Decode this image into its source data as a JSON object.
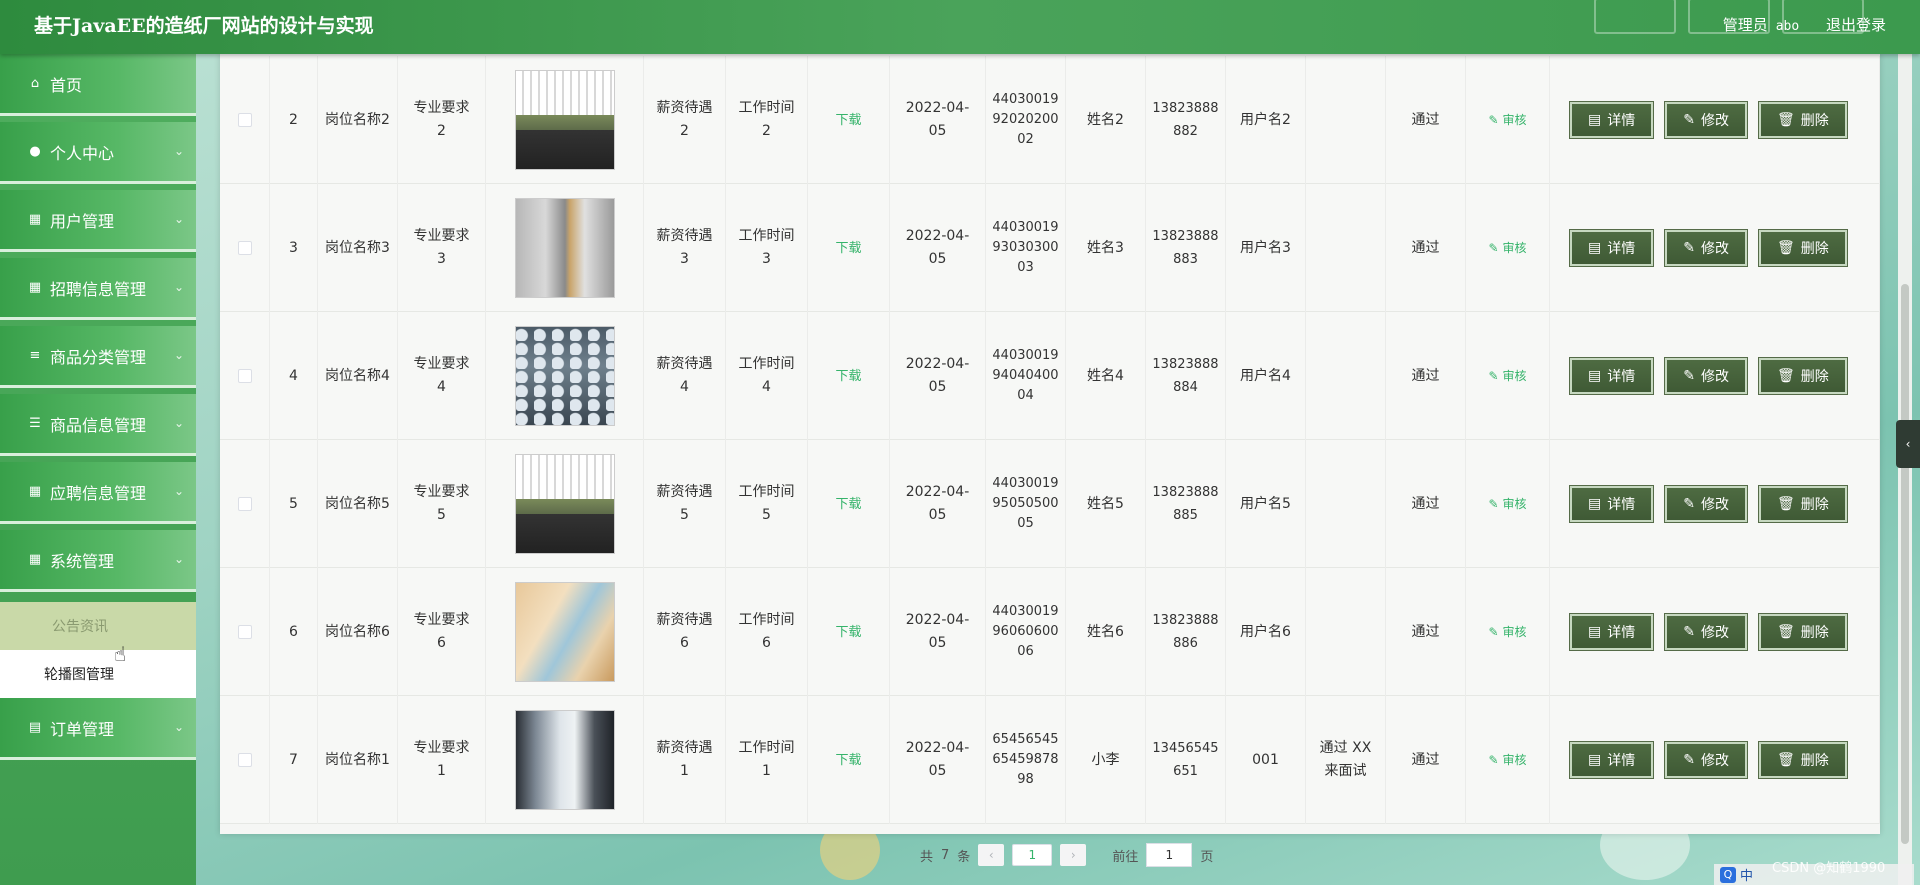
{
  "header": {
    "title": "基于JavaEE的造纸厂网站的设计与实现",
    "user_role": "管理员",
    "user_name": "abo",
    "logout": "退出登录"
  },
  "sidebar": {
    "items": [
      {
        "label": "首页",
        "icon": "home-icon"
      },
      {
        "label": "个人中心",
        "icon": "user-icon"
      },
      {
        "label": "用户管理",
        "icon": "grid-icon"
      },
      {
        "label": "招聘信息管理",
        "icon": "grid-icon"
      },
      {
        "label": "商品分类管理",
        "icon": "sliders-icon"
      },
      {
        "label": "商品信息管理",
        "icon": "list-icon"
      },
      {
        "label": "应聘信息管理",
        "icon": "grid-icon"
      },
      {
        "label": "系统管理",
        "icon": "grid-icon"
      }
    ],
    "submenu": [
      {
        "label": "公告资讯"
      },
      {
        "label": "轮播图管理"
      }
    ],
    "last_item": {
      "label": "订单管理",
      "icon": "clipboard-icon"
    }
  },
  "table": {
    "rows": [
      {
        "index": "2",
        "name": "岗位名称2",
        "req": [
          "专业要求",
          "2"
        ],
        "salary": [
          "薪资待遇",
          "2"
        ],
        "worktime": [
          "工作时间",
          "2"
        ],
        "download": "下载",
        "date": [
          "2022-04-",
          "05"
        ],
        "idno": [
          "44030019",
          "92020200",
          "02"
        ],
        "person": "姓名2",
        "phone": [
          "13823888",
          "882"
        ],
        "username": "用户名2",
        "reply": [],
        "status": "通过",
        "audit": "审核",
        "thumb": "office-bright"
      },
      {
        "index": "3",
        "name": "岗位名称3",
        "req": [
          "专业要求",
          "3"
        ],
        "salary": [
          "薪资待遇",
          "3"
        ],
        "worktime": [
          "工作时间",
          "3"
        ],
        "download": "下载",
        "date": [
          "2022-04-",
          "05"
        ],
        "idno": [
          "44030019",
          "93030300",
          "03"
        ],
        "person": "姓名3",
        "phone": [
          "13823888",
          "883"
        ],
        "username": "用户名3",
        "reply": [],
        "status": "通过",
        "audit": "审核",
        "thumb": "office-gray"
      },
      {
        "index": "4",
        "name": "岗位名称4",
        "req": [
          "专业要求",
          "4"
        ],
        "salary": [
          "薪资待遇",
          "4"
        ],
        "worktime": [
          "工作时间",
          "4"
        ],
        "download": "下载",
        "date": [
          "2022-04-",
          "05"
        ],
        "idno": [
          "44030019",
          "94040400",
          "04"
        ],
        "person": "姓名4",
        "phone": [
          "13823888",
          "884"
        ],
        "username": "用户名4",
        "reply": [],
        "status": "通过",
        "audit": "审核",
        "thumb": "office-crowd"
      },
      {
        "index": "5",
        "name": "岗位名称5",
        "req": [
          "专业要求",
          "5"
        ],
        "salary": [
          "薪资待遇",
          "5"
        ],
        "worktime": [
          "工作时间",
          "5"
        ],
        "download": "下载",
        "date": [
          "2022-04-",
          "05"
        ],
        "idno": [
          "44030019",
          "95050500",
          "05"
        ],
        "person": "姓名5",
        "phone": [
          "13823888",
          "885"
        ],
        "username": "用户名5",
        "reply": [],
        "status": "通过",
        "audit": "审核",
        "thumb": "office-bright"
      },
      {
        "index": "6",
        "name": "岗位名称6",
        "req": [
          "专业要求",
          "6"
        ],
        "salary": [
          "薪资待遇",
          "6"
        ],
        "worktime": [
          "工作时间",
          "6"
        ],
        "download": "下载",
        "date": [
          "2022-04-",
          "05"
        ],
        "idno": [
          "44030019",
          "96060600",
          "06"
        ],
        "person": "姓名6",
        "phone": [
          "13823888",
          "886"
        ],
        "username": "用户名6",
        "reply": [],
        "status": "通过",
        "audit": "审核",
        "thumb": "office-warm"
      },
      {
        "index": "7",
        "name": "岗位名称1",
        "req": [
          "专业要求",
          "1"
        ],
        "salary": [
          "薪资待遇",
          "1"
        ],
        "worktime": [
          "工作时间",
          "1"
        ],
        "download": "下载",
        "date": [
          "2022-04-",
          "05"
        ],
        "idno": [
          "65456545",
          "65459878",
          "98"
        ],
        "person": "小李",
        "phone": [
          "13456545",
          "651"
        ],
        "username": "001",
        "reply": [
          "通过 XX",
          "来面试"
        ],
        "status": "通过",
        "audit": "审核",
        "thumb": "office-glass"
      }
    ],
    "actions": {
      "detail": "详情",
      "edit": "修改",
      "delete": "删除"
    }
  },
  "pagination": {
    "total_prefix": "共",
    "total": "7",
    "total_suffix": "条",
    "current_page": "1",
    "goto_label": "前往",
    "goto_value": "1",
    "page_suffix": "页"
  },
  "overlay": {
    "watermark": "CSDN @知鹤1990",
    "ime_label": "中"
  },
  "colors": {
    "header_green": "#2e8b3e",
    "button_dark": "#4e6b42",
    "link_green": "#35b36a"
  }
}
